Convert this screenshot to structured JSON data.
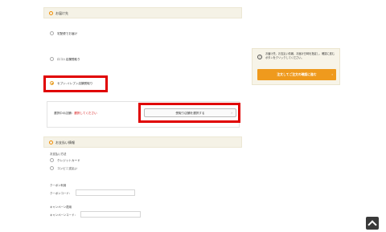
{
  "delivery_section": {
    "title": "お届け先",
    "options": [
      {
        "label": "宅配便でお届け",
        "checked": false
      },
      {
        "label": "ロコト店舗受取り",
        "checked": false
      },
      {
        "label": "セブン-イレブン店舗受取り",
        "checked": true
      }
    ],
    "store_label_prefix": "選択中の店舗：",
    "store_label_status": "選択してください",
    "store_button": "受取り店舗を選択する",
    "store_button_chevron": "›"
  },
  "payment_section": {
    "title": "お支払い情報",
    "method_label": "お支払い方法",
    "methods": [
      {
        "label": "クレジットカード",
        "checked": false
      },
      {
        "label": "コンビニ支払い",
        "checked": false
      }
    ],
    "coupon_title": "クーポン利用",
    "coupon_field_label": "クーポンコード：",
    "campaign_title": "キャンペーン適用",
    "campaign_field_label": "キャンペーンコード："
  },
  "side_panel": {
    "info_icon_glyph": "!",
    "message": "お届け先、お支払い情報、お届け日時を指定し、確認に進むボタンをクリックしてください。",
    "confirm_button": "注文してご注文の確認に進む",
    "confirm_chevron": "›"
  }
}
